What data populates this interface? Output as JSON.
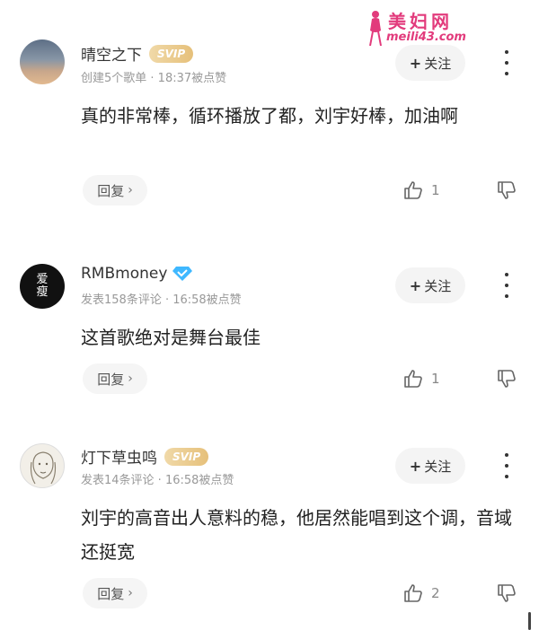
{
  "watermark": {
    "title": "美妇网",
    "url": "meili43.com"
  },
  "comments": [
    {
      "user": "晴空之下",
      "badge": "SVIP",
      "meta": "创建5个歌单 · 18:37被点赞",
      "text": "真的非常棒，循环播放了都，刘宇好棒，加油啊",
      "follow_label": "关注",
      "reply_label": "回复",
      "likes": "1"
    },
    {
      "user": "RMBmoney",
      "badge": "",
      "avatar_text": [
        "爱",
        "瘦"
      ],
      "meta": "发表158条评论 · 16:58被点赞",
      "text": "这首歌绝对是舞台最佳",
      "follow_label": "关注",
      "reply_label": "回复",
      "likes": "1"
    },
    {
      "user": "灯下草虫鸣",
      "badge": "SVIP",
      "meta": "发表14条评论 · 16:58被点赞",
      "text": "刘宇的高音出人意料的稳，他居然能唱到这个调，音域还挺宽",
      "follow_label": "关注",
      "reply_label": "回复",
      "likes": "2"
    }
  ],
  "colors": {
    "svip": "#e6c07a",
    "verify": "#3fb8ff",
    "watermark": "#e23b7c",
    "text": "#222222",
    "meta": "#999999"
  },
  "icons": {
    "like": "thumbs-up-icon",
    "dislike": "thumbs-down-icon",
    "more": "more-vertical-icon",
    "verified": "diamond-badge-icon"
  }
}
